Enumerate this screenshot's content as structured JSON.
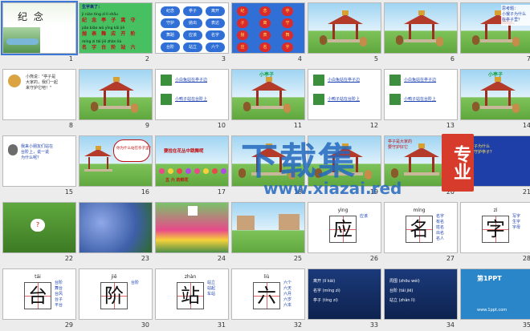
{
  "slides": [
    {
      "number": "1",
      "kind": "title",
      "title": "纪 念"
    },
    {
      "number": "2",
      "kind": "text_green",
      "heading": "生字来了：",
      "pinyin_rows": [
        "jì niàn tíng zǐ lí shǒu",
        "pāo biǎo wǔ yīng kāi jiē",
        "míng zì tái jiē zhàn liù"
      ],
      "han_rows": [
        "纪 念 亭 子 离 守",
        "抛 表 舞 应 开 阶",
        "名 字 台 阶 站 六"
      ]
    },
    {
      "number": "3",
      "kind": "bubbles_blue",
      "words": [
        "纪念",
        "亭子",
        "离开",
        "守护",
        "抛出",
        "表达",
        "舞蹈",
        "应该",
        "名字",
        "台阶",
        "站立",
        "六个"
      ]
    },
    {
      "number": "4",
      "kind": "bubbles_red",
      "chars": [
        "纪",
        "念",
        "亭",
        "子",
        "离",
        "守",
        "抛",
        "表",
        "舞",
        "应",
        "名",
        "字"
      ]
    },
    {
      "number": "5",
      "kind": "pavilion"
    },
    {
      "number": "6",
      "kind": "pavilion"
    },
    {
      "number": "7",
      "kind": "pavilion_text",
      "lines": [
        "思考题：",
        "小猴子为什么",
        "在亭子里？"
      ]
    },
    {
      "number": "8",
      "kind": "bear_text",
      "lines": [
        "小熊说：\"亭子是",
        "大家的，我们一起",
        "来守护它吧！\""
      ]
    },
    {
      "number": "9",
      "kind": "pavilion"
    },
    {
      "number": "10",
      "kind": "animals_text",
      "lines": [
        "小白兔站在亭子边",
        "小鸭子站在台阶上"
      ]
    },
    {
      "number": "11",
      "kind": "pavilion_label",
      "label": "小亭子"
    },
    {
      "number": "12",
      "kind": "animals_text",
      "lines": [
        "小白兔站在亭子边",
        "小鸭子站在台阶上"
      ]
    },
    {
      "number": "13",
      "kind": "animals_text",
      "lines": [
        "小白兔站在亭子边",
        "小鸭子站在台阶上"
      ]
    },
    {
      "number": "14",
      "kind": "pavilion_label",
      "label": "小亭子"
    },
    {
      "number": "15",
      "kind": "cat_text",
      "lines": [
        "我来小朋友们站在",
        "台阶上，说一说",
        "为什么呢？"
      ]
    },
    {
      "number": "16",
      "kind": "bubble_pavilion",
      "bubble": "你为什么站在亭子里？"
    },
    {
      "number": "17",
      "kind": "banner_flowers",
      "banner": "要捡在花丛中跳舞呢",
      "bottom": "五 六 的鲜花"
    },
    {
      "number": "18",
      "kind": "scene"
    },
    {
      "number": "19",
      "kind": "scene"
    },
    {
      "number": "20",
      "kind": "scene_text",
      "lines": [
        "亭子是大家的",
        "要守护好它"
      ]
    },
    {
      "number": "21",
      "kind": "question_text",
      "lines": [
        "小鸭子为什么",
        "应该守护亭子？"
      ]
    },
    {
      "number": "22",
      "kind": "grass_bubble",
      "bubble": "?"
    },
    {
      "number": "23",
      "kind": "flowers_blue"
    },
    {
      "number": "24",
      "kind": "flowers_sign"
    },
    {
      "number": "25",
      "kind": "village"
    },
    {
      "number": "26",
      "kind": "char",
      "pinyin": "yìng",
      "char": "应",
      "words": [
        "应该"
      ]
    },
    {
      "number": "27",
      "kind": "char",
      "pinyin": "míng",
      "char": "名",
      "words": [
        "名字",
        "有名",
        "姓名",
        "出名",
        "名人"
      ]
    },
    {
      "number": "28",
      "kind": "char",
      "pinyin": "zì",
      "char": "字",
      "words": [
        "写字",
        "生字",
        "字母"
      ]
    },
    {
      "number": "29",
      "kind": "char",
      "pinyin": "tái",
      "char": "台",
      "words": [
        "台阶",
        "舞台",
        "台风",
        "台子",
        "平台"
      ]
    },
    {
      "number": "30",
      "kind": "char",
      "pinyin": "jiē",
      "char": "阶",
      "words": [
        "台阶"
      ]
    },
    {
      "number": "31",
      "kind": "char",
      "pinyin": "zhàn",
      "char": "站",
      "words": [
        "站立",
        "站起",
        "车站"
      ]
    },
    {
      "number": "32",
      "kind": "char",
      "pinyin": "liù",
      "char": "六",
      "words": [
        "六个",
        "六天",
        "六月",
        "六岁",
        "六本"
      ]
    },
    {
      "number": "33",
      "kind": "dark_pinyin",
      "lines": [
        "离开 (lí kāi)",
        "名字 (míng zì)",
        "亭子 (tíng zi)"
      ]
    },
    {
      "number": "34",
      "kind": "dark_pinyin",
      "lines": [
        "周围 (zhōu wéi)",
        "台阶 (tái jiē)",
        "站立 (zhàn lì)"
      ]
    },
    {
      "number": "35",
      "kind": "ad",
      "brand": "第1PPT",
      "url": "www.1ppt.com"
    }
  ],
  "watermark": {
    "main": "下载集",
    "badge": "专业",
    "url": "www.xiazai.red"
  }
}
